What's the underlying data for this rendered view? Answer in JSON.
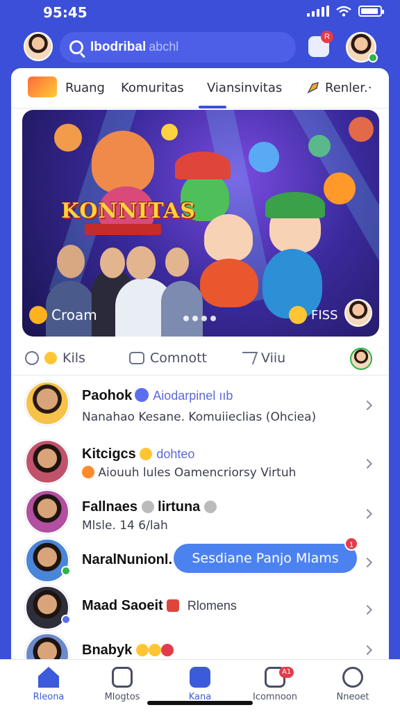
{
  "status": {
    "time": "95:45"
  },
  "header": {
    "search_query": "Ibodribal",
    "search_hint": "abchl",
    "notification_badge": "R"
  },
  "tabs": [
    "Ruang",
    "Komuritas",
    "Viansinvitas",
    "Renler.·"
  ],
  "hero": {
    "title": "KONNITAS",
    "left_label": "Croam",
    "right_label": "FISS",
    "dots": 4
  },
  "actions": {
    "like_label": "Kils",
    "comment_label": "Comnott",
    "share_label": "Viiu"
  },
  "list": [
    {
      "title": "Paohok",
      "meta": "Aiodarpinel ııb",
      "subtitle": "Nanahao Kesane. Komuiieclias (Ohciea)"
    },
    {
      "title": "Kitcigcs",
      "meta": "dohteo",
      "subtitle": "Aiouuh lules   Oamencriorsy Virtuh"
    },
    {
      "title": "Fallnaes",
      "meta": "lirtuna",
      "subtitle": "Mlsle. 14 6/lah"
    },
    {
      "title": "NaralNunionl.",
      "chip_label": "Sesdiane   Panjo Mlams",
      "chip_badge": "1"
    },
    {
      "title": "Maad Saoeit",
      "meta": "Rlomens"
    },
    {
      "title": "Bnabyk",
      "meta": ""
    }
  ],
  "bottom_nav": [
    {
      "label": "Rleona",
      "icon": "home-icon"
    },
    {
      "label": "Mlogtos",
      "icon": "chat-icon"
    },
    {
      "label": "Kana",
      "icon": "compose-icon"
    },
    {
      "label": "Icomnoon",
      "icon": "inbox-icon",
      "badge": "A1"
    },
    {
      "label": "Nneoet",
      "icon": "search-icon"
    }
  ],
  "colors": {
    "brand": "#3b4fd8",
    "accent": "#3b5bdb",
    "chip": "#4c82ef",
    "badge": "#e43b4a",
    "online": "#2fb34a"
  }
}
